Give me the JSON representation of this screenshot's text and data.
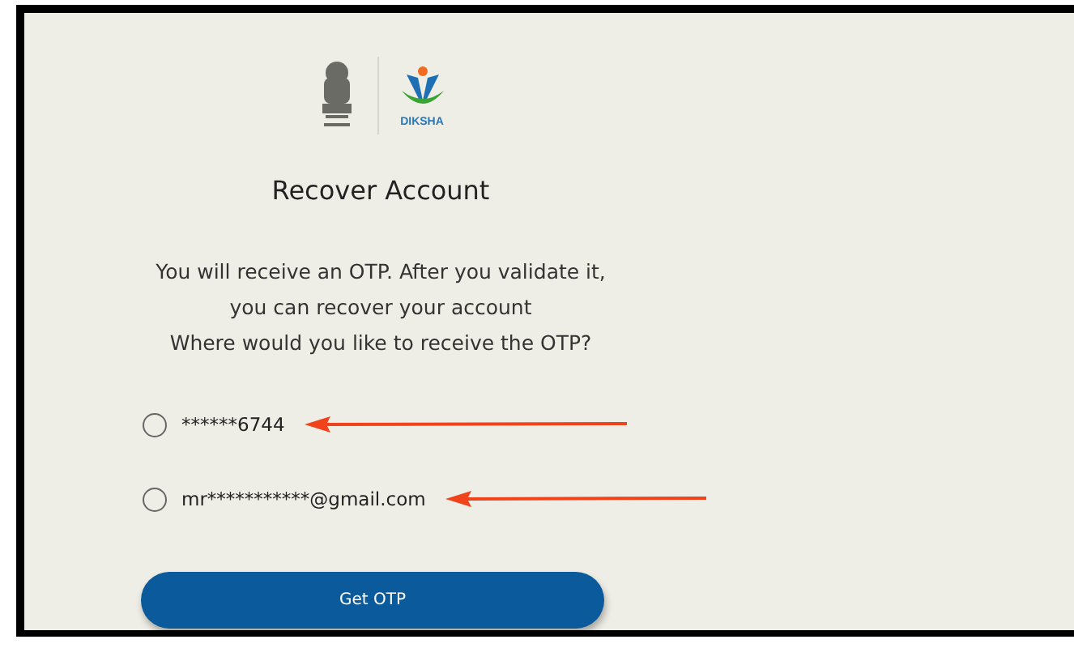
{
  "logo": {
    "brand": "DIKSHA"
  },
  "title": "Recover Account",
  "message": [
    "You will receive an OTP. After you validate it,",
    "you can recover your account",
    "Where would you like to receive the OTP?"
  ],
  "options": [
    {
      "label": "******6744",
      "selected": false
    },
    {
      "label": "mr***********@gmail.com",
      "selected": false
    }
  ],
  "button": "Get OTP"
}
